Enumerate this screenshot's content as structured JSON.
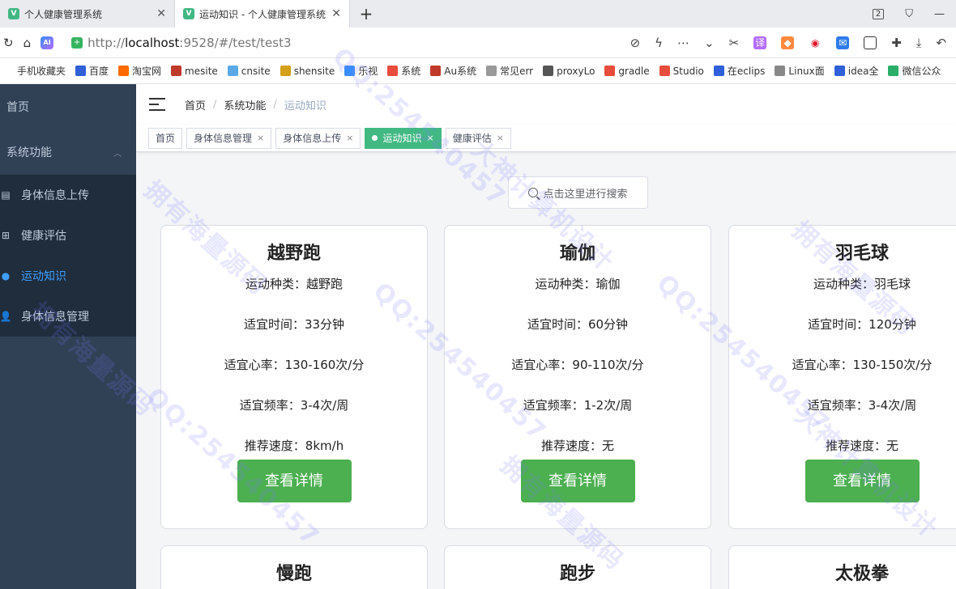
{
  "browser": {
    "tabs": [
      {
        "title": "个人健康管理系统",
        "active": false
      },
      {
        "title": "运动知识 - 个人健康管理系统",
        "active": true
      }
    ],
    "tab_count_badge": "2",
    "url": "http://localhost:9528/#/test/test3",
    "url_host": "localhost",
    "url_rest": ":9528/#/test/test3",
    "url_scheme": "http://"
  },
  "bookmarks": [
    {
      "label": "手机收藏夹",
      "color": "#ffffff"
    },
    {
      "label": "百度",
      "color": "#2f5fd9"
    },
    {
      "label": "淘宝网",
      "color": "#ff6a00"
    },
    {
      "label": "mesite",
      "color": "#c0392b"
    },
    {
      "label": "cnsite",
      "color": "#5aa9e6"
    },
    {
      "label": "shensite",
      "color": "#d4a017"
    },
    {
      "label": "乐视",
      "color": "#3a8dff"
    },
    {
      "label": "系统",
      "color": "#e74c3c"
    },
    {
      "label": "Au系统",
      "color": "#c0392b"
    },
    {
      "label": "常见err",
      "color": "#999999"
    },
    {
      "label": "proxyLo",
      "color": "#555555"
    },
    {
      "label": "gradle",
      "color": "#e74c3c"
    },
    {
      "label": "Studio",
      "color": "#e74c3c"
    },
    {
      "label": "在eclips",
      "color": "#2f5fd9"
    },
    {
      "label": "Linux面",
      "color": "#888888"
    },
    {
      "label": "idea全",
      "color": "#2f5fd9"
    },
    {
      "label": "微信公众",
      "color": "#2aae67"
    }
  ],
  "sidebar": {
    "home": "首页",
    "group": "系统功能",
    "items": [
      {
        "label": "身体信息上传",
        "icon": "upload-icon",
        "active": false
      },
      {
        "label": "健康评估",
        "icon": "plus-square-icon",
        "active": false
      },
      {
        "label": "运动知识",
        "icon": "bulb-icon",
        "active": true
      },
      {
        "label": "身体信息管理",
        "icon": "user-icon",
        "active": false
      }
    ]
  },
  "breadcrumb": {
    "items": [
      "首页",
      "系统功能",
      "运动知识"
    ]
  },
  "tags": [
    {
      "label": "首页",
      "closable": false,
      "active": false
    },
    {
      "label": "身体信息管理",
      "closable": true,
      "active": false
    },
    {
      "label": "身体信息上传",
      "closable": true,
      "active": false
    },
    {
      "label": "运动知识",
      "closable": true,
      "active": true
    },
    {
      "label": "健康评估",
      "closable": true,
      "active": false
    }
  ],
  "search": {
    "placeholder": "点击这里进行搜索"
  },
  "cards": [
    {
      "title": "越野跑",
      "fields": [
        "运动种类：越野跑",
        "适宜时间：33分钟",
        "适宜心率：130-160次/分",
        "适宜频率：3-4次/周",
        "推荐速度：8km/h"
      ],
      "button": "查看详情"
    },
    {
      "title": "瑜伽",
      "fields": [
        "运动种类：瑜伽",
        "适宜时间：60分钟",
        "适宜心率：90-110次/分",
        "适宜频率：1-2次/周",
        "推荐速度：无"
      ],
      "button": "查看详情"
    },
    {
      "title": "羽毛球",
      "fields": [
        "运动种类：羽毛球",
        "适宜时间：120分钟",
        "适宜心率：130-150次/分",
        "适宜频率：3-4次/周",
        "推荐速度：无"
      ],
      "button": "查看详情"
    }
  ],
  "cards_row2": [
    {
      "title": "慢跑"
    },
    {
      "title": "跑步"
    },
    {
      "title": "太极拳"
    }
  ],
  "watermarks": [
    "QQ:2545404​57",
    "大神计算机设计",
    "拥有海量源码"
  ],
  "colors": {
    "sidebar_bg": "#304156",
    "sidebar_sub_bg": "#1f2d3d",
    "sidebar_active": "#409eff",
    "tag_active": "#42b983",
    "detail_button": "#4caf50"
  }
}
